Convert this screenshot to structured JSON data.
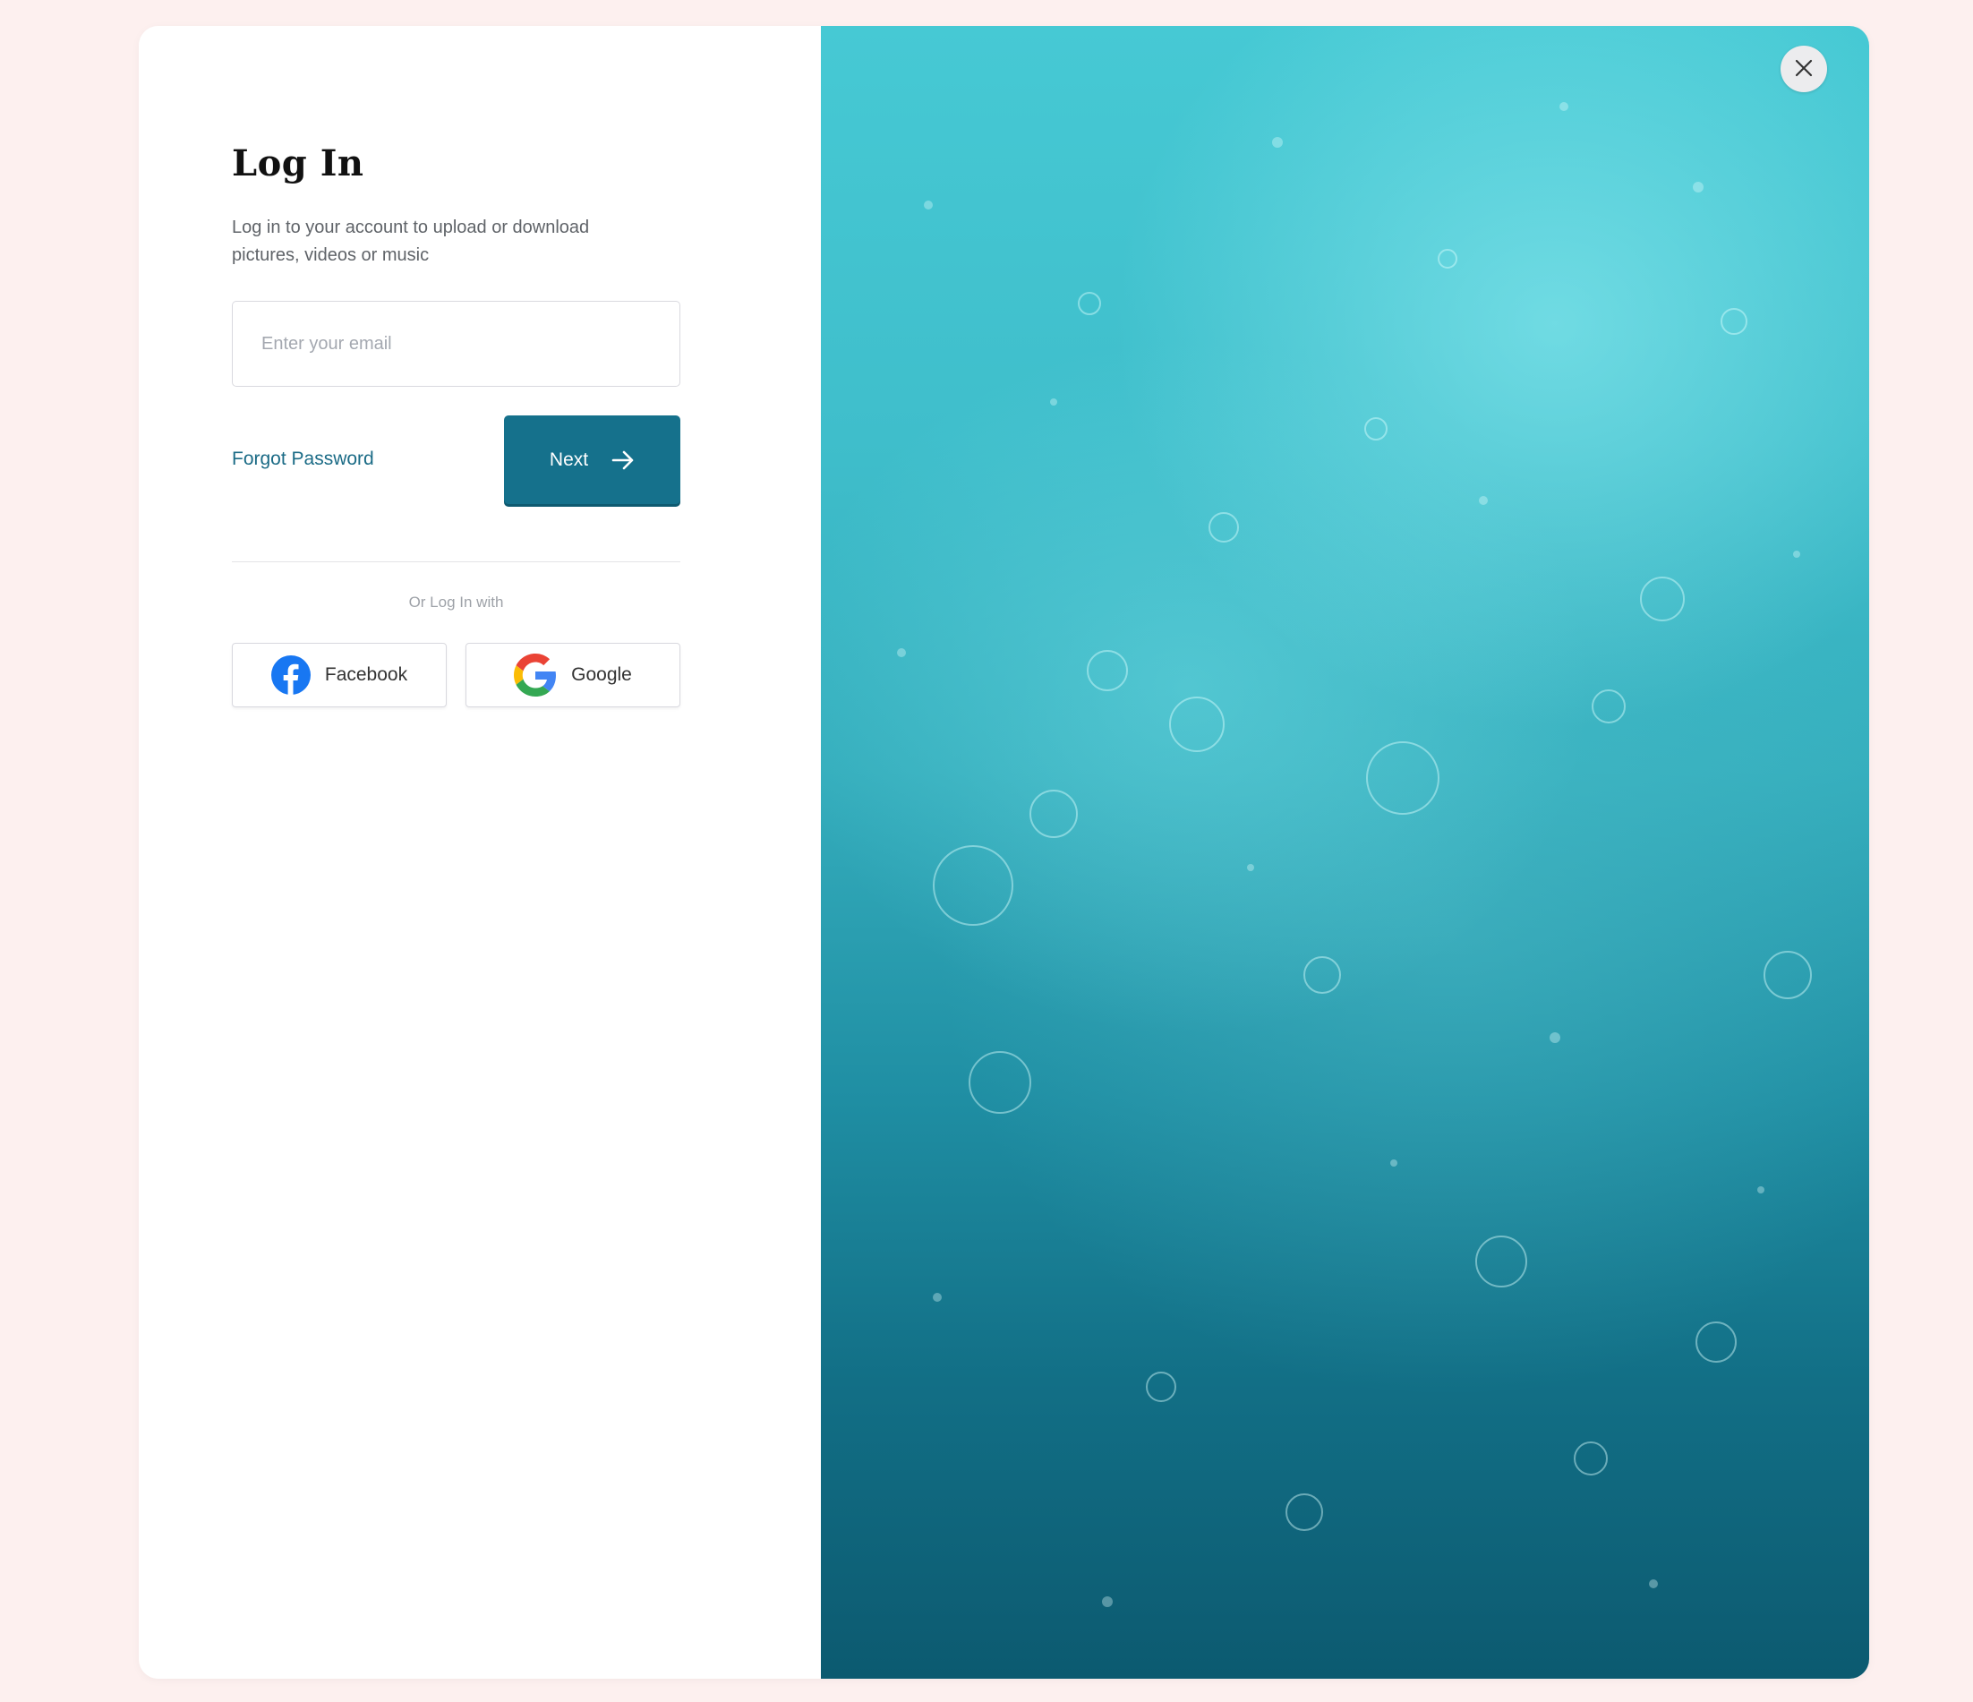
{
  "login": {
    "title": "Log In",
    "subtitle": "Log in to your account to upload or download pictures, videos or music",
    "email": {
      "value": "",
      "placeholder": "Enter your email"
    },
    "forgot_password": "Forgot Password",
    "next_label": "Next",
    "social_divider": "Or Log In with",
    "facebook_label": "Facebook",
    "google_label": "Google"
  },
  "icons": {
    "next": "arrow-right-icon",
    "facebook": "facebook-icon",
    "google": "google-icon",
    "close": "close-icon",
    "background": "water-photo"
  },
  "colors": {
    "page_background": "#fdf0ef",
    "accent": "#15718c",
    "link": "#1b6b86",
    "facebook_blue": "#1877f2"
  }
}
